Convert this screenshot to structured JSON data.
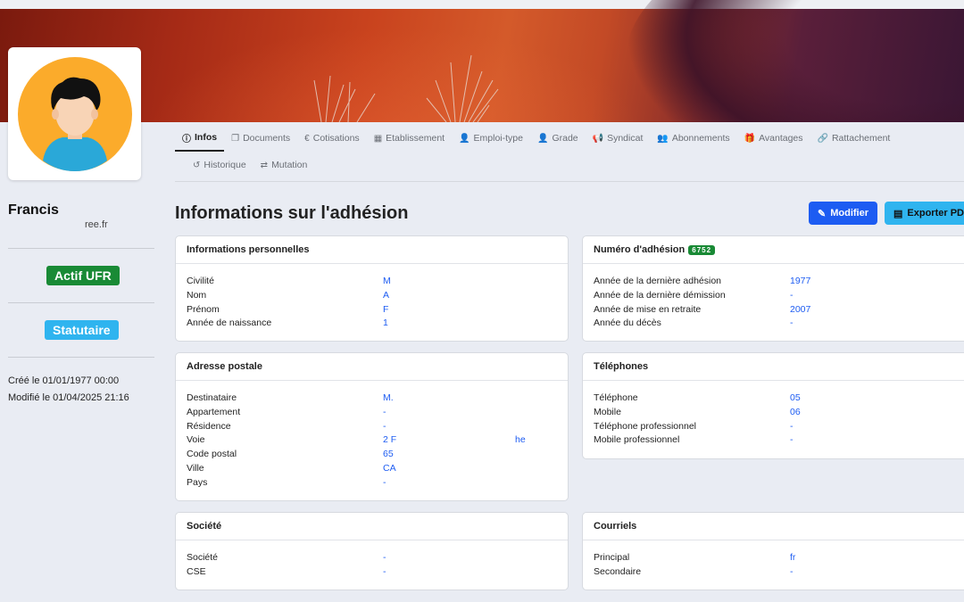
{
  "colors": {
    "primary": "#1d5cf2",
    "success": "#198a35",
    "info": "#2fb4ef"
  },
  "user": {
    "name": "Francis",
    "email": "ree.fr",
    "status_badge": "Actif UFR",
    "type_badge": "Statutaire",
    "created": "Créé le 01/01/1977 00:00",
    "modified": "Modifié le 01/04/2025 21:16"
  },
  "tabs": [
    {
      "label": "Infos",
      "icon": "info-icon",
      "glyph": "ⓘ"
    },
    {
      "label": "Documents",
      "icon": "documents-icon",
      "glyph": "❐"
    },
    {
      "label": "Cotisations",
      "icon": "euro-icon",
      "glyph": "€"
    },
    {
      "label": "Etablissement",
      "icon": "building-icon",
      "glyph": "▦"
    },
    {
      "label": "Emploi-type",
      "icon": "user-icon",
      "glyph": "👤"
    },
    {
      "label": "Grade",
      "icon": "user-grade-icon",
      "glyph": "👤"
    },
    {
      "label": "Syndicat",
      "icon": "megaphone-icon",
      "glyph": "📢"
    },
    {
      "label": "Abonnements",
      "icon": "users-icon",
      "glyph": "👥"
    },
    {
      "label": "Avantages",
      "icon": "gift-icon",
      "glyph": "🎁"
    },
    {
      "label": "Rattachement",
      "icon": "link-icon",
      "glyph": "🔗"
    },
    {
      "label": "Historique",
      "icon": "history-icon",
      "glyph": "↺"
    },
    {
      "label": "Mutation",
      "icon": "exchange-icon",
      "glyph": "⇄"
    }
  ],
  "page_title": "Informations sur l'adhésion",
  "actions": {
    "modifier": "Modifier",
    "export": "Exporter PDF"
  },
  "cards": {
    "personal": {
      "title": "Informations personnelles",
      "rows": [
        {
          "label": "Civilité",
          "value": "M"
        },
        {
          "label": "Nom",
          "value": "A"
        },
        {
          "label": "Prénom",
          "value": "F"
        },
        {
          "label": "Année de naissance",
          "value": "1"
        }
      ]
    },
    "membership": {
      "title": "Numéro d'adhésion",
      "number": "6752",
      "rows": [
        {
          "label": "Année de la dernière adhésion",
          "value": "1977"
        },
        {
          "label": "Année de la dernière démission",
          "value": "-"
        },
        {
          "label": "Année de mise en retraite",
          "value": "2007"
        },
        {
          "label": "Année du décès",
          "value": "-"
        }
      ]
    },
    "address": {
      "title": "Adresse postale",
      "rows": [
        {
          "label": "Destinataire",
          "value": "M."
        },
        {
          "label": "Appartement",
          "value": "-"
        },
        {
          "label": "Résidence",
          "value": "-"
        },
        {
          "label": "Voie",
          "value": "2 F",
          "extra": "he"
        },
        {
          "label": "Code postal",
          "value": "65"
        },
        {
          "label": "Ville",
          "value": "CA"
        },
        {
          "label": "Pays",
          "value": "-"
        }
      ]
    },
    "phones": {
      "title": "Téléphones",
      "rows": [
        {
          "label": "Téléphone",
          "value": "05"
        },
        {
          "label": "Mobile",
          "value": "06"
        },
        {
          "label": "Téléphone professionnel",
          "value": "-"
        },
        {
          "label": "Mobile professionnel",
          "value": "-"
        }
      ]
    },
    "company": {
      "title": "Société",
      "rows": [
        {
          "label": "Société",
          "value": "-"
        },
        {
          "label": "CSE",
          "value": "-"
        }
      ]
    },
    "emails": {
      "title": "Courriels",
      "rows": [
        {
          "label": "Principal",
          "value": "fr"
        },
        {
          "label": "Secondaire",
          "value": "-"
        }
      ]
    }
  }
}
